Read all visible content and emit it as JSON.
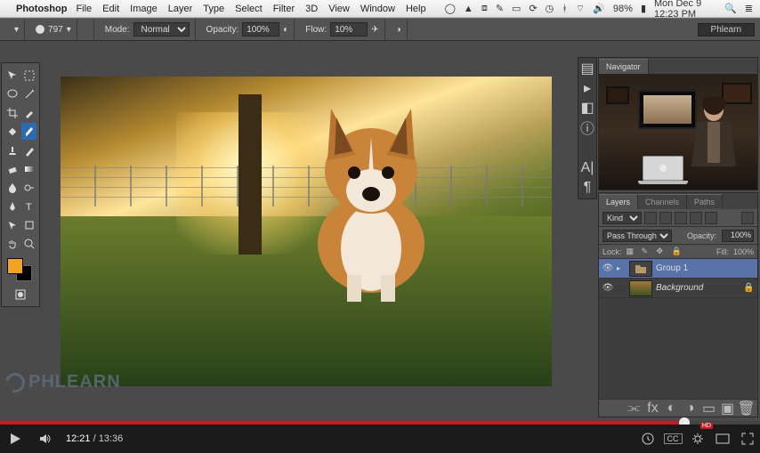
{
  "mac_menu": {
    "app_name": "Photoshop",
    "items": [
      "File",
      "Edit",
      "Image",
      "Layer",
      "Type",
      "Select",
      "Filter",
      "3D",
      "View",
      "Window",
      "Help"
    ],
    "battery": "98%",
    "clock": "Mon Dec 9  12:23 PM"
  },
  "options_bar": {
    "brush_size": "797",
    "mode_label": "Mode:",
    "mode_value": "Normal",
    "opacity_label": "Opacity:",
    "opacity_value": "100%",
    "flow_label": "Flow:",
    "flow_value": "10%",
    "workspace": "Phlearn"
  },
  "swatch": {
    "fg": "#f2a421",
    "bg": "#000000"
  },
  "panels": {
    "navigator_tab": "Navigator",
    "layers_tabs": [
      "Layers",
      "Channels",
      "Paths"
    ]
  },
  "layers_panel": {
    "filter_kind": "Kind",
    "blend_mode": "Pass Through",
    "opacity_label": "Opacity:",
    "opacity_value": "100%",
    "lock_label": "Lock:",
    "fill_label": "Fill:",
    "fill_value": "100%",
    "rows": [
      {
        "name": "Group 1",
        "type": "group",
        "selected": true
      },
      {
        "name": "Background",
        "type": "image",
        "locked": true
      }
    ]
  },
  "watermark": "PHLEARN",
  "youtube": {
    "current_time": "12:21",
    "duration": "13:36",
    "progress_pct": 90,
    "cc_label": "CC",
    "hd_badge": "HD"
  }
}
